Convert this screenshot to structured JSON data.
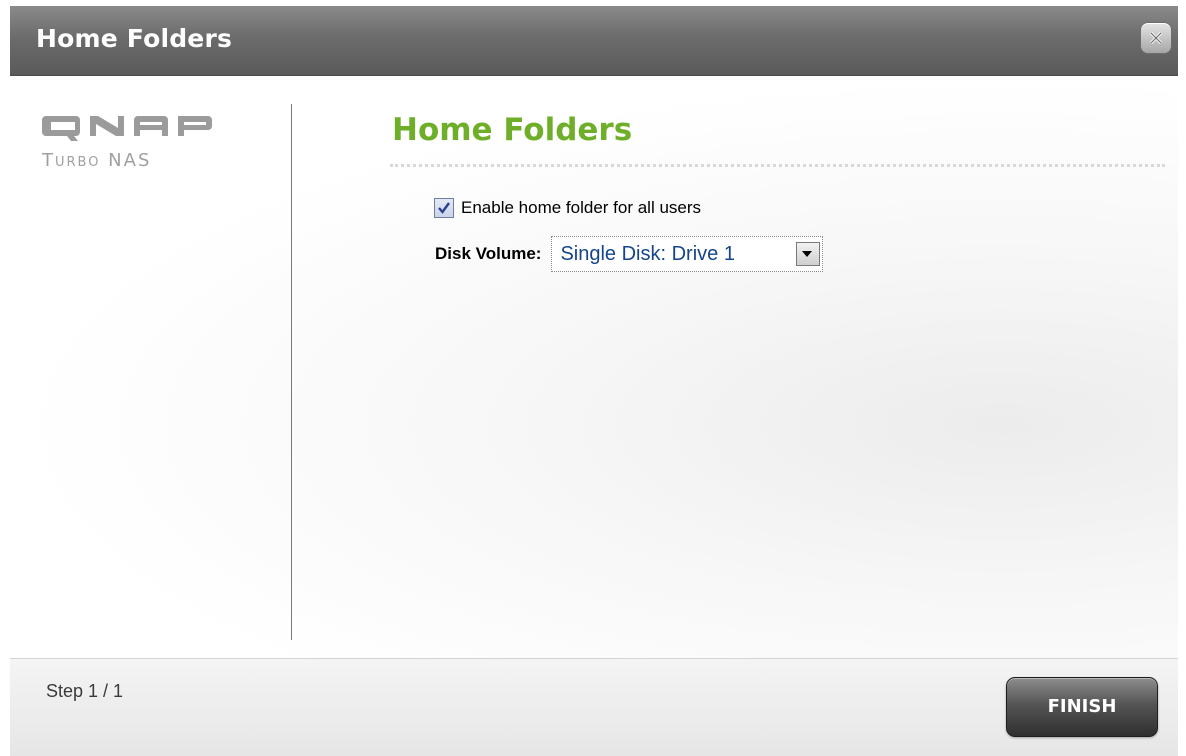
{
  "window": {
    "title": "Home Folders",
    "close_icon": "close-icon"
  },
  "logo": {
    "brand": "QNAP",
    "subtitle": "Turbo NAS"
  },
  "main": {
    "title": "Home Folders",
    "enable_checkbox": {
      "label": "Enable home folder for all users",
      "checked": true
    },
    "disk_volume": {
      "label": "Disk Volume:",
      "selected": "Single Disk: Drive 1"
    }
  },
  "footer": {
    "step": "Step 1 / 1",
    "finish_label": "FINISH"
  },
  "colors": {
    "title_green": "#6fae28",
    "select_text_blue": "#15458b",
    "titlebar_gray": "#6c6c6c"
  }
}
